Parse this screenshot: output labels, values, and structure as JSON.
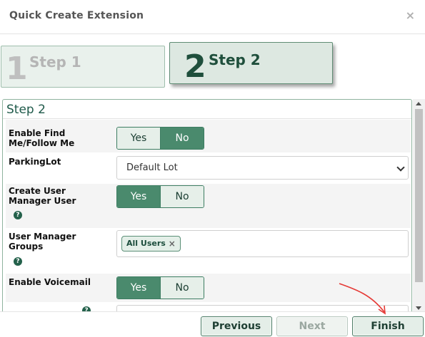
{
  "dialog": {
    "title": "Quick Create Extension",
    "close_label": "×"
  },
  "steps": [
    {
      "number": "1",
      "label": "Step 1",
      "active": false
    },
    {
      "number": "2",
      "label": "Step 2",
      "active": true
    }
  ],
  "panel": {
    "title": "Step 2"
  },
  "fields": {
    "find_me": {
      "label": "Enable Find Me/Follow Me",
      "yes": "Yes",
      "no": "No",
      "selected": "No"
    },
    "parking_lot": {
      "label": "ParkingLot",
      "value": "Default Lot"
    },
    "create_um_user": {
      "label": "Create User Manager User",
      "help": "?",
      "yes": "Yes",
      "no": "No",
      "selected": "Yes"
    },
    "um_groups": {
      "label": "User Manager Groups",
      "help": "?",
      "tags": [
        "All Users"
      ],
      "tag_remove": "×"
    },
    "voicemail": {
      "label": "Enable Voicemail",
      "yes": "Yes",
      "no": "No",
      "selected": "Yes"
    },
    "next_row": {
      "help": "?"
    }
  },
  "footer": {
    "previous_label": "Previous",
    "next_label": "Next",
    "finish_label": "Finish"
  },
  "colors": {
    "accent": "#4a8a6d",
    "annotation_arrow": "#e53935"
  }
}
